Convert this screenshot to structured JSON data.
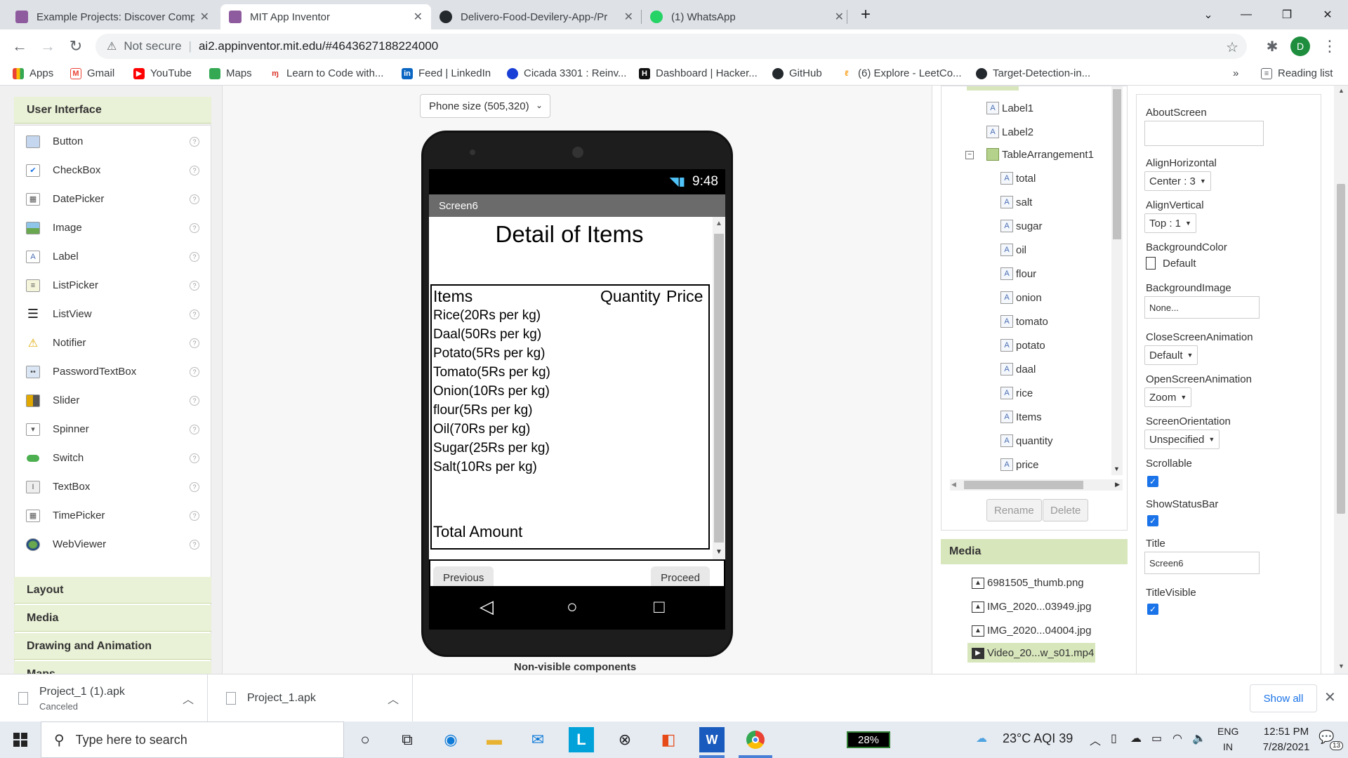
{
  "browser": {
    "tabs": [
      {
        "title": "Example Projects: Discover Comp",
        "active": false
      },
      {
        "title": "MIT App Inventor",
        "active": true
      },
      {
        "title": "Delivero-Food-Devilery-App-/Pr",
        "active": false
      },
      {
        "title": "(1) WhatsApp",
        "active": false
      }
    ],
    "not_secure": "Not secure",
    "url": "ai2.appinventor.mit.edu/#4643627188224000",
    "profile_initial": "D",
    "bookmarks": [
      "Apps",
      "Gmail",
      "YouTube",
      "Maps",
      "Learn to Code with...",
      "Feed | LinkedIn",
      "Cicada 3301 : Reinv...",
      "Dashboard | Hacker...",
      "GitHub",
      "(6) Explore - LeetCo...",
      "Target-Detection-in..."
    ],
    "bookmarks_more": "»",
    "reading_list": "Reading list"
  },
  "palette": {
    "active_category": "User Interface",
    "items": [
      "Button",
      "CheckBox",
      "DatePicker",
      "Image",
      "Label",
      "ListPicker",
      "ListView",
      "Notifier",
      "PasswordTextBox",
      "Slider",
      "Spinner",
      "Switch",
      "TextBox",
      "TimePicker",
      "WebViewer"
    ],
    "other_categories": [
      "Layout",
      "Media",
      "Drawing and Animation",
      "Maps"
    ],
    "help_glyph": "?"
  },
  "viewer": {
    "phone_size": "Phone size (505,320)",
    "time": "9:48",
    "screen_name": "Screen6",
    "title": "Detail of Items",
    "table": {
      "headers": {
        "items": "Items",
        "quantity": "Quantity",
        "price": "Price"
      },
      "rows": [
        "Rice(20Rs per kg)",
        "Daal(50Rs per kg)",
        "Potato(5Rs per kg)",
        "Tomato(5Rs per kg)",
        "Onion(10Rs per kg)",
        "flour(5Rs per kg)",
        "Oil(70Rs per kg)",
        "Sugar(25Rs per kg)",
        "Salt(10Rs per kg)"
      ],
      "total_label": "Total Amount"
    },
    "btn_previous": "Previous",
    "btn_proceed": "Proceed",
    "nonvisible": "Non-visible components"
  },
  "tree": {
    "nodes": [
      {
        "label": "Label1",
        "type": "label",
        "indent": 0
      },
      {
        "label": "Label2",
        "type": "label",
        "indent": 0
      },
      {
        "label": "TableArrangement1",
        "type": "table",
        "indent": 0
      },
      {
        "label": "total",
        "type": "label",
        "indent": 1
      },
      {
        "label": "salt",
        "type": "label",
        "indent": 1
      },
      {
        "label": "sugar",
        "type": "label",
        "indent": 1
      },
      {
        "label": "oil",
        "type": "label",
        "indent": 1
      },
      {
        "label": "flour",
        "type": "label",
        "indent": 1
      },
      {
        "label": "onion",
        "type": "label",
        "indent": 1
      },
      {
        "label": "tomato",
        "type": "label",
        "indent": 1
      },
      {
        "label": "potato",
        "type": "label",
        "indent": 1
      },
      {
        "label": "daal",
        "type": "label",
        "indent": 1
      },
      {
        "label": "rice",
        "type": "label",
        "indent": 1
      },
      {
        "label": "Items",
        "type": "label",
        "indent": 1
      },
      {
        "label": "quantity",
        "type": "label",
        "indent": 1
      },
      {
        "label": "price",
        "type": "label",
        "indent": 1
      }
    ],
    "rename": "Rename",
    "delete": "Delete"
  },
  "media": {
    "header": "Media",
    "files": [
      "6981505_thumb.png",
      "IMG_2020...03949.jpg",
      "IMG_2020...04004.jpg",
      "Video_20...w_s01.mp4"
    ]
  },
  "properties": {
    "about_screen": {
      "label": "AboutScreen",
      "value": ""
    },
    "align_horizontal": {
      "label": "AlignHorizontal",
      "value": "Center : 3"
    },
    "align_vertical": {
      "label": "AlignVertical",
      "value": "Top : 1"
    },
    "background_color": {
      "label": "BackgroundColor",
      "value": "Default"
    },
    "background_image": {
      "label": "BackgroundImage",
      "value": "None..."
    },
    "close_animation": {
      "label": "CloseScreenAnimation",
      "value": "Default"
    },
    "open_animation": {
      "label": "OpenScreenAnimation",
      "value": "Zoom"
    },
    "orientation": {
      "label": "ScreenOrientation",
      "value": "Unspecified"
    },
    "scrollable": {
      "label": "Scrollable",
      "checked": true
    },
    "show_status_bar": {
      "label": "ShowStatusBar",
      "checked": true
    },
    "title": {
      "label": "Title",
      "value": "Screen6"
    },
    "title_visible": {
      "label": "TitleVisible",
      "checked": true
    }
  },
  "downloads": {
    "items": [
      {
        "name": "Project_1 (1).apk",
        "status": "Canceled"
      },
      {
        "name": "Project_1.apk",
        "status": ""
      }
    ],
    "show_all": "Show all"
  },
  "taskbar": {
    "search_placeholder": "Type here to search",
    "battery": "28%",
    "weather": "23°C  AQI 39",
    "lang": "ENG",
    "region": "IN",
    "time": "12:51 PM",
    "date": "7/28/2021",
    "notifications": "13"
  }
}
